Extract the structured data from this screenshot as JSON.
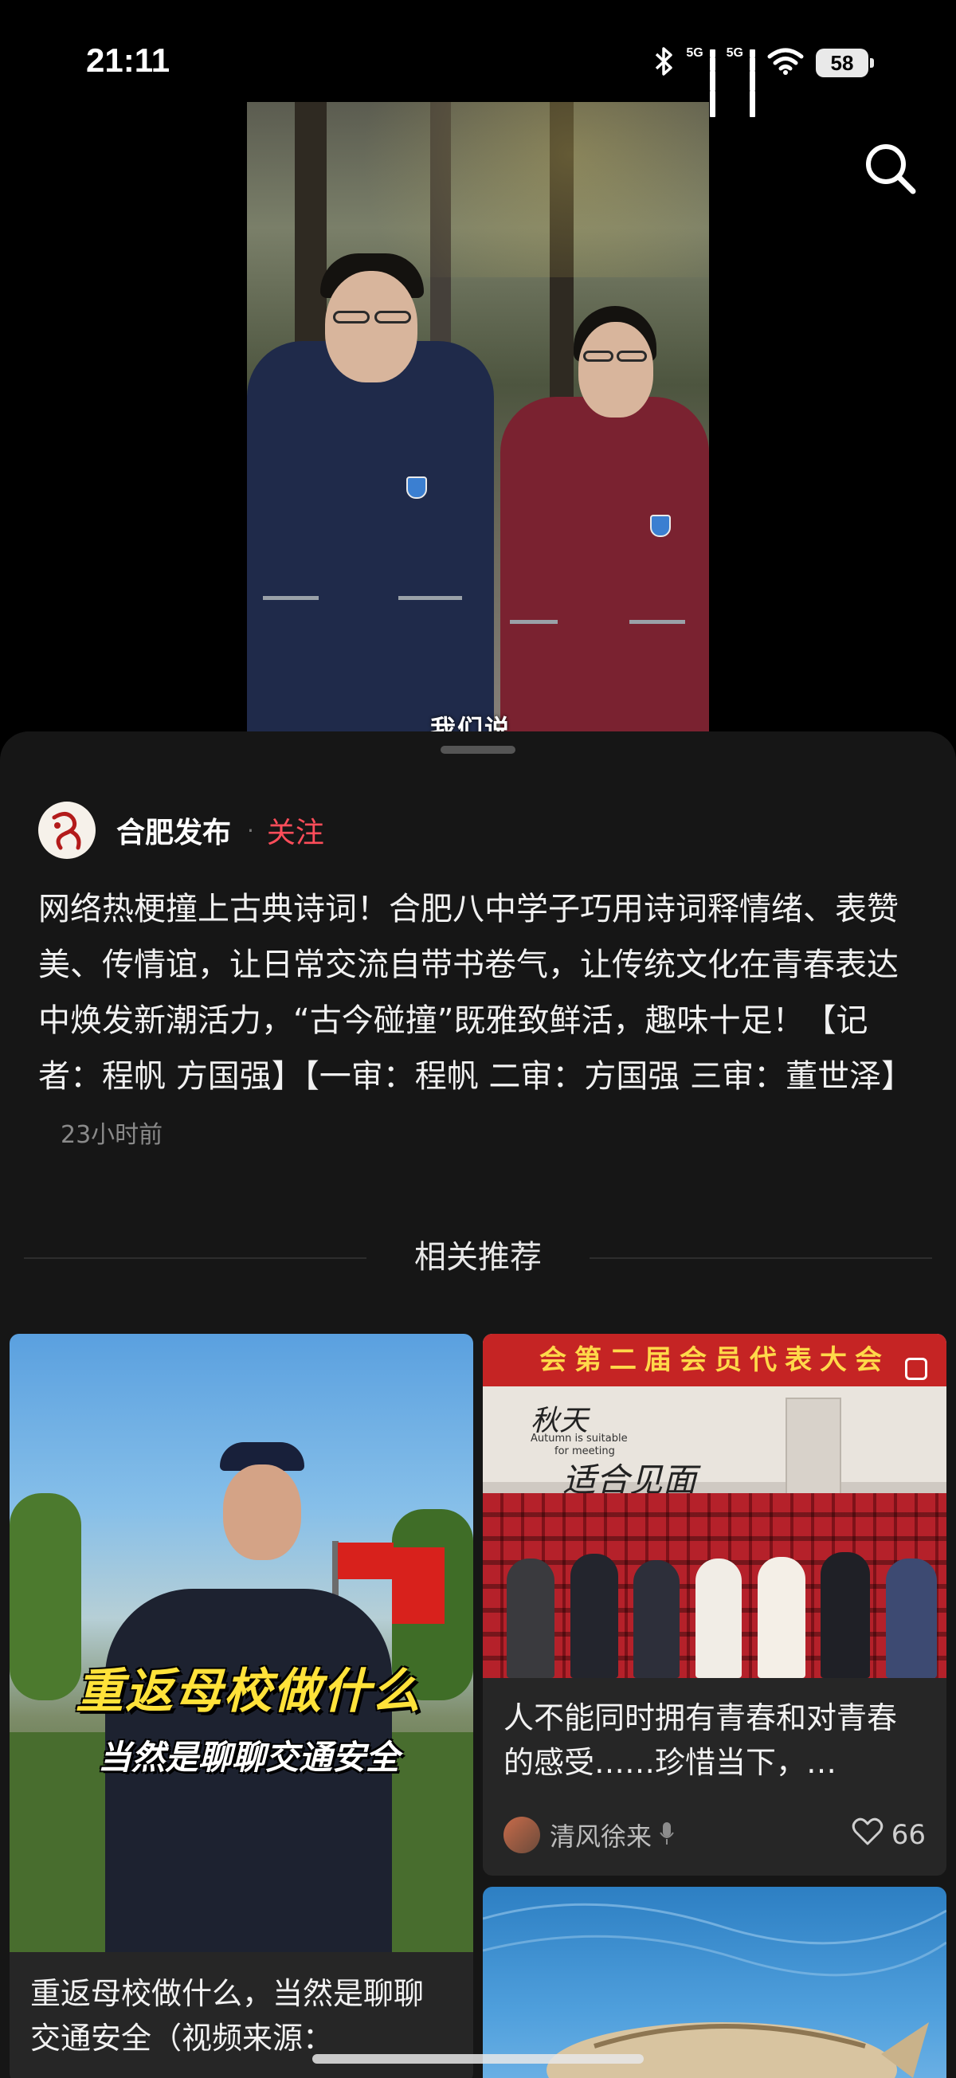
{
  "status_bar": {
    "time": "21:11",
    "network_1": "5G",
    "network_2": "5G",
    "battery": "58"
  },
  "video": {
    "caption_fragment": "我们说"
  },
  "post": {
    "author": "合肥发布",
    "separator": "·",
    "follow_label": "关注",
    "description": "网络热梗撞上古典诗词！合肥八中学子巧用诗词释情绪、表赞美、传情谊，让日常交流自带书卷气，让传统文化在青春表达中焕发新潮活力，“古今碰撞”既雅致鲜活，趣味十足！【记者：程帆 方国强】【一审：程帆 二审：方国强 三审：董世泽】",
    "time_ago": "23小时前"
  },
  "related": {
    "title": "相关推荐",
    "cards": [
      {
        "overlay_line1": "重返母校做什么",
        "overlay_line2": "当然是聊聊交通安全",
        "title": "重返母校做什么，当然是聊聊交通安全（视频来源：",
        "flag_text": ""
      },
      {
        "banner": "会第二届会员代表大会",
        "handwriting_1": "秋天",
        "handwriting_2": "Autumn is suitable",
        "handwriting_3": "for meeting",
        "handwriting_4": "适合见面",
        "title": "人不能同时拥有青春和对青春的感受……珍惜当下，…",
        "author": "清风徐来",
        "likes": "66"
      },
      {
        "title": ""
      }
    ]
  },
  "colors": {
    "accent_follow": "#ff4d5a",
    "sheet_bg": "#161616",
    "card_bg": "#262626"
  }
}
